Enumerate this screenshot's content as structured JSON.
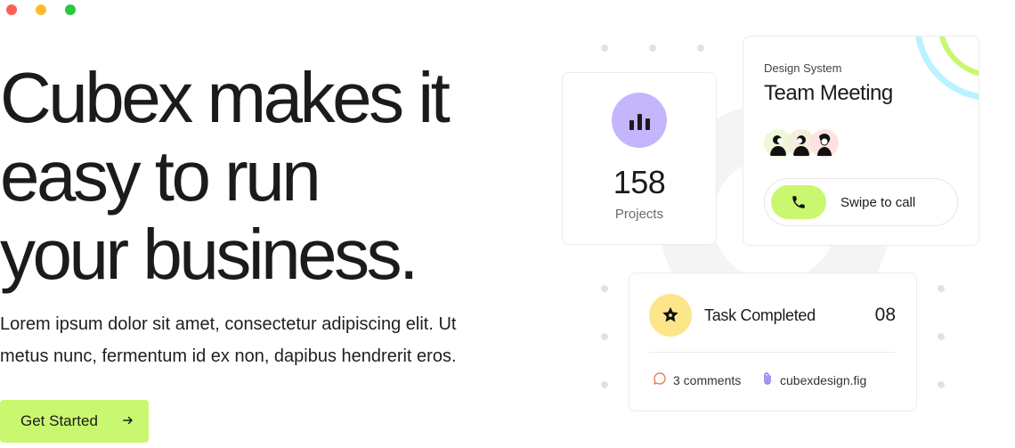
{
  "window": {
    "controls": [
      "close",
      "minimize",
      "maximize"
    ]
  },
  "hero": {
    "title_lines": [
      "Cubex makes it",
      "easy to run",
      "your business."
    ],
    "description": "Lorem ipsum dolor sit amet, consectetur adipiscing elit. Ut metus nunc, fermentum id ex non, dapibus hendrerit eros.",
    "cta_label": "Get Started",
    "cta_icon": "arrow-right-icon"
  },
  "projects_card": {
    "icon": "bar-chart-icon",
    "count": "158",
    "label": "Projects"
  },
  "meeting_card": {
    "subtitle": "Design System",
    "title": "Team Meeting",
    "avatars": [
      "avatar-1",
      "avatar-2",
      "avatar-3"
    ],
    "call_icon": "phone-icon",
    "call_label": "Swipe to call"
  },
  "task_card": {
    "icon": "star-badge-icon",
    "title": "Task Completed",
    "count": "08",
    "comments": "3 comments",
    "attachment": "cubexdesign.fig"
  },
  "colors": {
    "accent_lime": "#c9f76f",
    "accent_purple": "#c4b5fd",
    "accent_yellow": "#fde68a",
    "accent_cyan": "#b8f3ff"
  }
}
